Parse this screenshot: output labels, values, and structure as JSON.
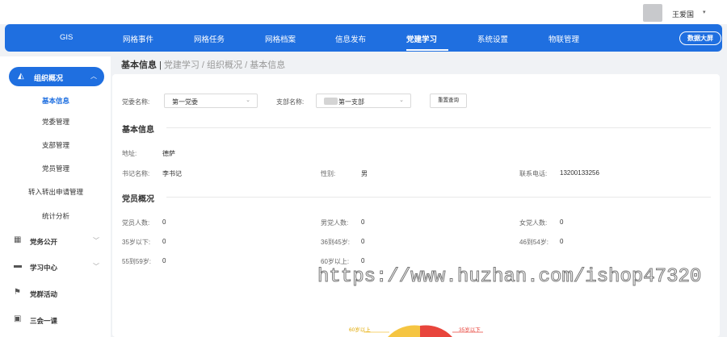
{
  "header": {
    "username": "王爱国",
    "caret": "▾"
  },
  "nav": {
    "items": [
      "GIS",
      "网格事件",
      "网格任务",
      "网格档案",
      "信息发布",
      "党建学习",
      "系统设置",
      "物联管理"
    ],
    "active_index": 5,
    "screen_button": "数据大屏"
  },
  "sidebar": {
    "active_group": "组织概况",
    "subitems": [
      "基本信息",
      "党委管理",
      "支部管理",
      "党员管理",
      "转入转出申请管理",
      "统计分析"
    ],
    "current_sub": 0,
    "groups": [
      "党务公开",
      "学习中心",
      "党群活动",
      "三会一课"
    ]
  },
  "breadcrumb": {
    "current": "基本信息",
    "separator": "|",
    "path": "党建学习 / 组织概况 / 基本信息"
  },
  "filters": {
    "party_label": "党委名称:",
    "party_value": "第一党委",
    "branch_label": "支部名称:",
    "branch_value": "第一支部",
    "query_button": "重置查询"
  },
  "basic_info": {
    "title": "基本信息",
    "address_label": "地址:",
    "address_value": "德萨",
    "secretary_label": "书记名称:",
    "secretary_value": "李书记",
    "gender_label": "性别:",
    "gender_value": "男",
    "phone_label": "联系电话:",
    "phone_value": "13200133256"
  },
  "members": {
    "title": "党员概况",
    "rows": [
      [
        {
          "k": "党员人数:",
          "v": "0"
        },
        {
          "k": "男党人数:",
          "v": "0"
        },
        {
          "k": "女党人数:",
          "v": "0"
        }
      ],
      [
        {
          "k": "35岁以下:",
          "v": "0"
        },
        {
          "k": "36到45岁:",
          "v": "0"
        },
        {
          "k": "46到54岁:",
          "v": "0"
        }
      ],
      [
        {
          "k": "55到59岁:",
          "v": "0"
        },
        {
          "k": "60岁以上:",
          "v": "0"
        }
      ]
    ]
  },
  "chart": {
    "label_left": "60岁以上",
    "label_right": "35岁以下",
    "colors": {
      "left": "#f5c542",
      "right": "#e8453c"
    }
  },
  "watermark": "https://www.huzhan.com/ishop47320"
}
